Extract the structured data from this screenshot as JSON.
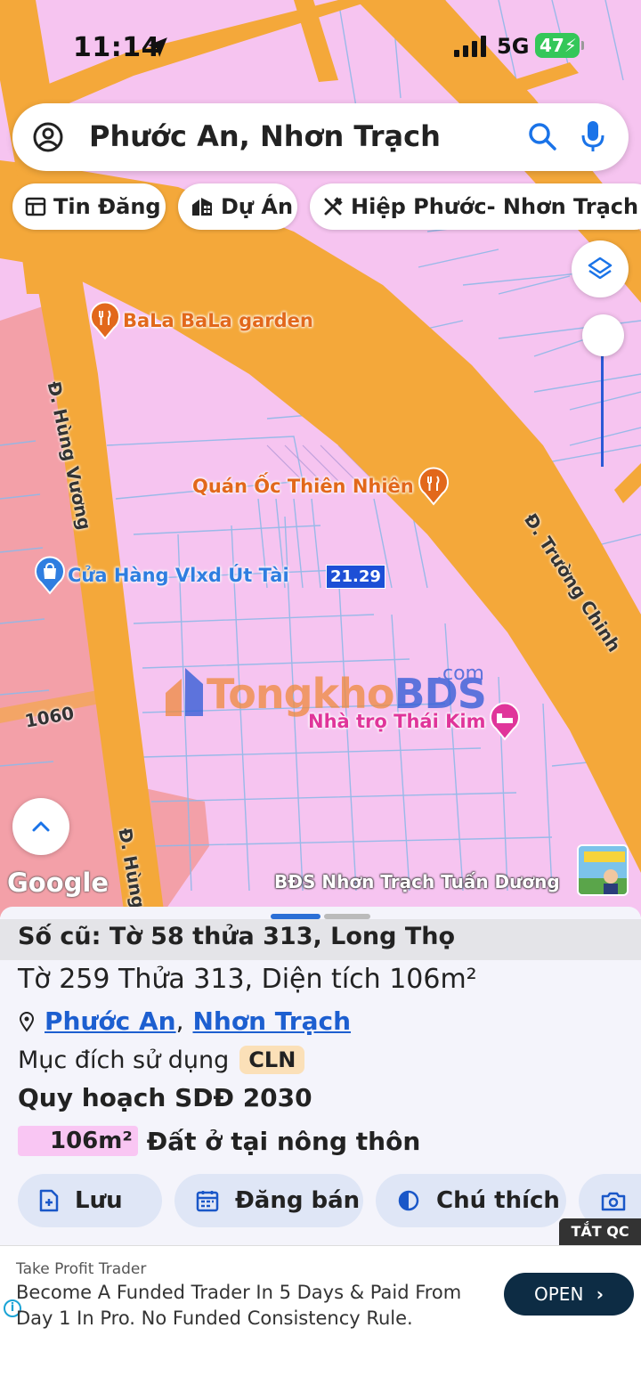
{
  "status_bar": {
    "time": "11:14",
    "network": "5G",
    "battery": "47"
  },
  "search": {
    "query": "Phước An, Nhơn Trạch"
  },
  "chips": [
    {
      "label": "Tin Đăng",
      "icon": "listing-icon"
    },
    {
      "label": "Dự Án",
      "icon": "project-icon"
    },
    {
      "label": "Hiệp Phước- Nhơn Trạch d",
      "icon": "tools-icon"
    }
  ],
  "map": {
    "pois": [
      {
        "name": "BaLa BaLa garden",
        "type": "restaurant",
        "color": "#e2681b"
      },
      {
        "name": "Quán Ốc Thiên Nhiên",
        "type": "restaurant",
        "color": "#e2681b"
      },
      {
        "name": "Cửa Hàng Vlxd Út Tài",
        "type": "shop",
        "color": "#2f7ee0"
      },
      {
        "name": "Nhà trọ Thái Kim",
        "type": "lodging",
        "color": "#e0359a"
      }
    ],
    "roads": {
      "hung_vuong": "Đ. Hùng Vương",
      "hung_vuong_short": "Đ. Hùng",
      "truong_chinh": "Đ. Trường Chinh",
      "road_1060": "1060"
    },
    "parcel_tag": "21.29",
    "watermark": {
      "part1": "Tongkho",
      "part2": "BDS",
      "suffix": ".com"
    },
    "google": "Google",
    "attribution": "BĐS Nhơn Trạch Tuấn Dương",
    "colors": {
      "residential": "#f6c4f0",
      "road": "#f4a83a",
      "commercial": "#f3a0a8",
      "parcel_lines": "#8fb8e8"
    }
  },
  "sheet": {
    "old_ref": "Số cũ: Tờ 58 thửa 313, Long Thọ",
    "parcel": "Tờ 259 Thửa 313, Diện tích 106m²",
    "ward": "Phước An",
    "district": "Nhơn Trạch",
    "purpose_label": "Mục đích sử dụng",
    "purpose_code": "CLN",
    "plan_title": "Quy hoạch SDĐ 2030",
    "plan_area": "106m²",
    "plan_desc": "Đất ở tại nông thôn",
    "actions": [
      {
        "label": "Lưu",
        "icon": "save-doc-icon"
      },
      {
        "label": "Đăng bán",
        "icon": "calendar-icon"
      },
      {
        "label": "Chú thích",
        "icon": "legend-icon"
      },
      {
        "label": "",
        "icon": "add-photo-icon"
      }
    ]
  },
  "ad": {
    "close_label": "TẮT QC",
    "brand": "Take Profit Trader",
    "text": "Become A Funded Trader In 5 Days & Paid From Day 1 In Pro. No Funded Consistency Rule.",
    "cta": "OPEN"
  }
}
